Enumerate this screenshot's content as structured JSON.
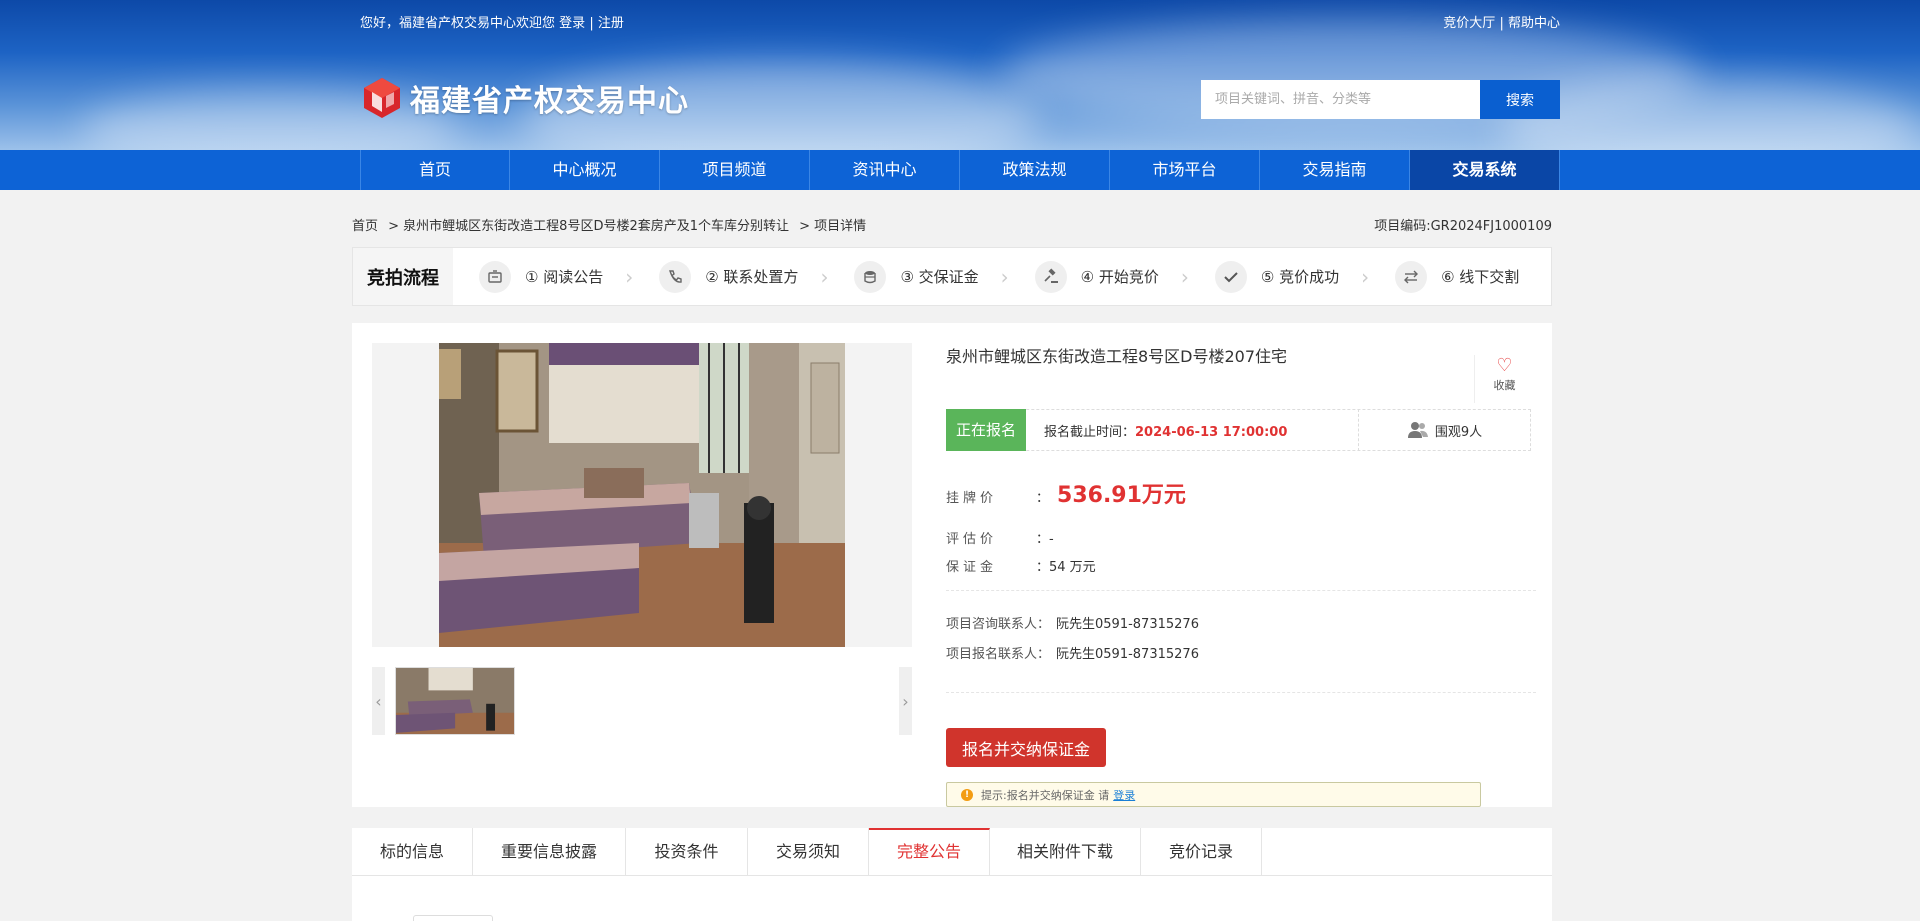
{
  "topbar": {
    "welcome": "您好，福建省产权交易中心欢迎您",
    "login": "登录",
    "sep": "|",
    "register": "注册",
    "hall": "竞价大厅",
    "help": "帮助中心"
  },
  "logo": {
    "text": "福建省产权交易中心"
  },
  "search": {
    "placeholder": "项目关键词、拼音、分类等",
    "button": "搜索"
  },
  "nav": [
    "首页",
    "中心概况",
    "项目频道",
    "资讯中心",
    "政策法规",
    "市场平台",
    "交易指南",
    "交易系统"
  ],
  "breadcrumb": {
    "home": "首页",
    "category": "> 泉州市鲤城区东街改造工程8号区D号楼2套房产及1个车库分别转让",
    "current": "> 项目详情",
    "code": "项目编码:GR2024FJ1000109"
  },
  "process": {
    "title": "竞拍流程",
    "steps": [
      {
        "label": "① 阅读公告",
        "icon": "notice-icon"
      },
      {
        "label": "② 联系处置方",
        "icon": "phone-icon"
      },
      {
        "label": "③ 交保证金",
        "icon": "coins-icon"
      },
      {
        "label": "④ 开始竞价",
        "icon": "gavel-icon"
      },
      {
        "label": "⑤ 竞价成功",
        "icon": "check-icon"
      },
      {
        "label": "⑥ 线下交割",
        "icon": "exchange-icon"
      }
    ]
  },
  "project": {
    "title": "泉州市鲤城区东街改造工程8号区D号楼207住宅",
    "fav": "收藏",
    "status": "正在报名",
    "deadline_label": "报名截止时间：",
    "deadline": "2024-06-13 17:00:00",
    "views": "围观9人",
    "list_price_label": "挂牌价",
    "list_price_colon": "：",
    "list_price": "536.91万元",
    "assess_label": "评估价",
    "assess_value": "：-",
    "deposit_label": "保证金",
    "deposit_value": "：54 万元",
    "consult_label": "项目咨询联系人：",
    "consult_value": "阮先生0591-87315276",
    "signup_label": "项目报名联系人：",
    "signup_value": "阮先生0591-87315276",
    "apply_button": "报名并交纳保证金",
    "hint_text": "提示:报名并交纳保证金 请",
    "hint_link": "登录"
  },
  "tabs": [
    "标的信息",
    "重要信息披露",
    "投资条件",
    "交易须知",
    "完整公告",
    "相关附件下载",
    "竞价记录"
  ],
  "active_tab": "完整公告",
  "colors": {
    "brand_blue": "#0d63d6",
    "accent_red": "#e03232",
    "status_green": "#5ab55a"
  }
}
